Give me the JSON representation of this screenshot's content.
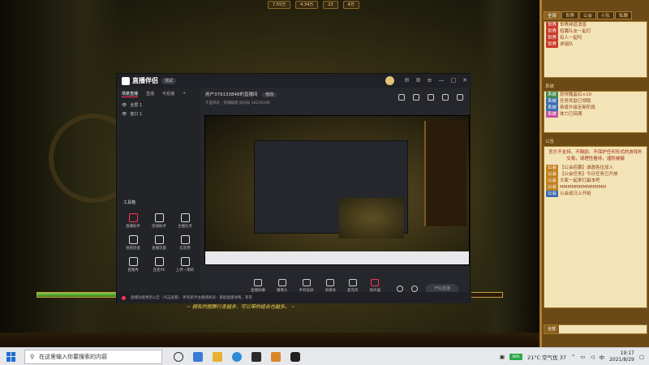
{
  "game": {
    "resources": [
      "7.55万",
      "4.34万",
      "23",
      "4万"
    ],
    "hp_fraction": 0.2,
    "hint": "~ 拥有的图腾行走越多，可以带的组合也越多。 ~"
  },
  "app": {
    "name": "直播伴侣",
    "badge": "测试",
    "left_tabs": [
      "场景直播",
      "直播",
      "可看播"
    ],
    "scenes": [
      "全屏 1",
      "窗口 1"
    ],
    "tools_title": "工具箱",
    "tools": [
      "直播助手",
      "连线助手",
      "主播任务",
      "视频连麦",
      "直播流量",
      "信息用",
      "直播秀",
      "连麦PK",
      "上传一期的"
    ],
    "room_title": "用户379133848的直播间",
    "room_tag": "修改",
    "room_sub": "千里风云 · 英雄联盟    房间号  16234196",
    "bottom_tools": [
      "直播屏幕",
      "摄像头",
      "手机投屏",
      "多媒体",
      "麦克风",
      "扬声器"
    ],
    "start_button": "开始直播",
    "footer_text": "直播功能更新公告（点击查看）  所有新手主播请阅读：基础直播攻略，等等"
  },
  "chat": {
    "tabs": [
      "全部",
      "世界",
      "公会",
      "小队",
      "私聊",
      "系统消息"
    ],
    "world_lines": [
      {
        "tag": "世界",
        "text": "世界频道消息"
      },
      {
        "tag": "世界",
        "text": "招募队友一起打"
      },
      {
        "tag": "世界",
        "text": "有人一起吗"
      },
      {
        "tag": "世界",
        "text": "求组队"
      }
    ],
    "system_label": "系统",
    "system_lines": [
      {
        "tag": "系统",
        "text": "获得魔晶石×10"
      },
      {
        "tag": "系统",
        "text": "任务奖励已领取"
      },
      {
        "tag": "系统",
        "text": "恭喜升级至新阶段"
      },
      {
        "tag": "系统",
        "text": "体力已回满"
      }
    ],
    "guild_label": "公告",
    "notice": "官方不支持、不鼓励、不保护任何形式的游戏外交易，请理性看待，谨防被骗",
    "guild_lines": [
      {
        "tag": "公会",
        "text": "【公会招募】诚邀各位加入"
      },
      {
        "tag": "公会",
        "text": "【公会任务】今日任务已开放"
      },
      {
        "tag": "公会",
        "text": "大家一起来打副本吧"
      },
      {
        "tag": "公会",
        "text": "MMMMMMMMMMMM"
      },
      {
        "tag": "公会",
        "text": "公会战马上开始"
      }
    ],
    "input_channel": "全部"
  },
  "taskbar": {
    "search_placeholder": "在这里输入你要搜索的内容",
    "battery": "68%",
    "weather": "21°C 空气优 37",
    "time": "19:17",
    "date": "2021/8/29"
  }
}
